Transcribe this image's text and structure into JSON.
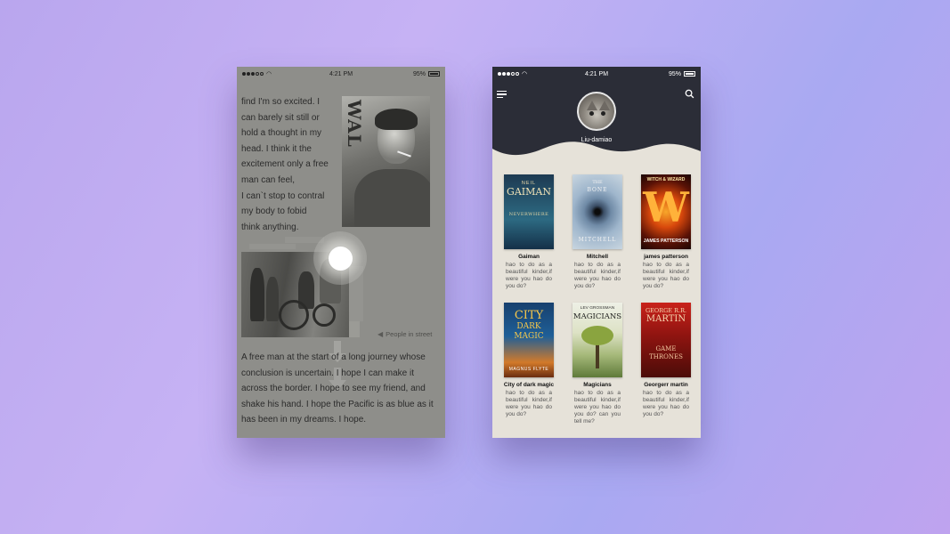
{
  "status_bar": {
    "time": "4:21 PM",
    "battery": "95%"
  },
  "reader": {
    "para1_lines": [
      "find I'm so excited. I",
      "can barely sit still or",
      "hold a thought in my",
      "head. I think it the",
      "excitement only a free",
      "man can feel,",
      "I can`t stop to contral",
      "my body to fobid",
      "think anything."
    ],
    "photo_caption": "People in street",
    "photo1_text": "WAL",
    "para2_lines": [
      "A free man at the start of a long journey whose",
      "conclusion is uncertain. I hope I can make it",
      "across the border. I hope to see my friend, and",
      "shake his hand. I hope the Pacific is as blue as it",
      "has been in my dreams. I hope."
    ]
  },
  "library": {
    "username": "Liu-damiao",
    "books": [
      {
        "title": "Gaiman",
        "desc": "hao to do as a beautiful kinder,if were you hao do you do?",
        "cover_top": "NEIL",
        "cover_main": "GAIMAN",
        "cover_sub": "NEVERWHERE"
      },
      {
        "title": "Mitchell",
        "desc": "hao to do as a beautiful kinder,if were you hao do you do?",
        "cover_top": "THE",
        "cover_main": "BONE",
        "cover_sub": "MITCHELL"
      },
      {
        "title": "james patterson",
        "desc": "hao to do as a beautiful kinder,if were you hao do you do?",
        "cover_top": "WITCH & WIZARD",
        "cover_main": "W",
        "cover_sub": "JAMES PATTERSON"
      },
      {
        "title": "City of dark magic",
        "desc": "hao to do as a beautiful kinder,if were you hao do you do?",
        "cover_top": "CITY",
        "cover_main": "DARK MAGIC",
        "cover_sub": "MAGNUS FLYTE"
      },
      {
        "title": "Magicians",
        "desc": "hao to do as a beautiful kinder,if were you hao do you do? can you tell me?",
        "cover_top": "LEV GROSSMAN",
        "cover_main": "MAGICIANS",
        "cover_sub": ""
      },
      {
        "title": "Georgerr martin",
        "desc": "hao to do as a beautiful kinder,if were you hao do you do?",
        "cover_top": "GEORGE R.R.",
        "cover_main": "MARTIN",
        "cover_sub": "GAME THRONES"
      }
    ]
  },
  "colors": {
    "reader_bg": "#8e8e8a",
    "library_header": "#2b2d37",
    "library_bg": "#e6e2d9"
  },
  "icons": [
    "wifi-icon",
    "battery-icon",
    "menu-icon",
    "search-icon",
    "play-triangle-icon",
    "down-arrow-icon"
  ]
}
